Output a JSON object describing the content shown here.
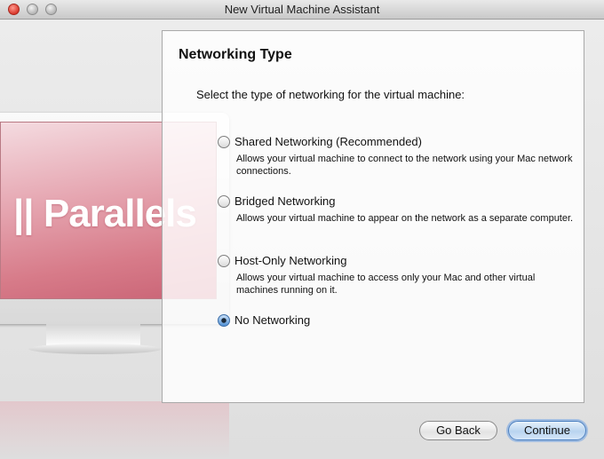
{
  "window": {
    "title": "New Virtual Machine Assistant"
  },
  "illustration": {
    "logo_text": "|| Parallels"
  },
  "panel": {
    "title": "Networking Type",
    "instruction": "Select the type of networking for the virtual machine:",
    "options": [
      {
        "label": "Shared Networking (Recommended)",
        "description": "Allows your virtual machine to connect to the network using your Mac network connections.",
        "selected": false
      },
      {
        "label": "Bridged Networking",
        "description": "Allows your virtual machine to appear on the network as a separate computer.",
        "selected": false
      },
      {
        "label": "Host-Only Networking",
        "description": "Allows your virtual machine to access only your Mac and other virtual machines running on it.",
        "selected": false
      },
      {
        "label": "No Networking",
        "description": "",
        "selected": true
      }
    ]
  },
  "buttons": {
    "back": "Go Back",
    "continue": "Continue"
  },
  "colors": {
    "accent": "#4f8fd3",
    "close": "#d9382c",
    "screen": "#d77b89"
  }
}
